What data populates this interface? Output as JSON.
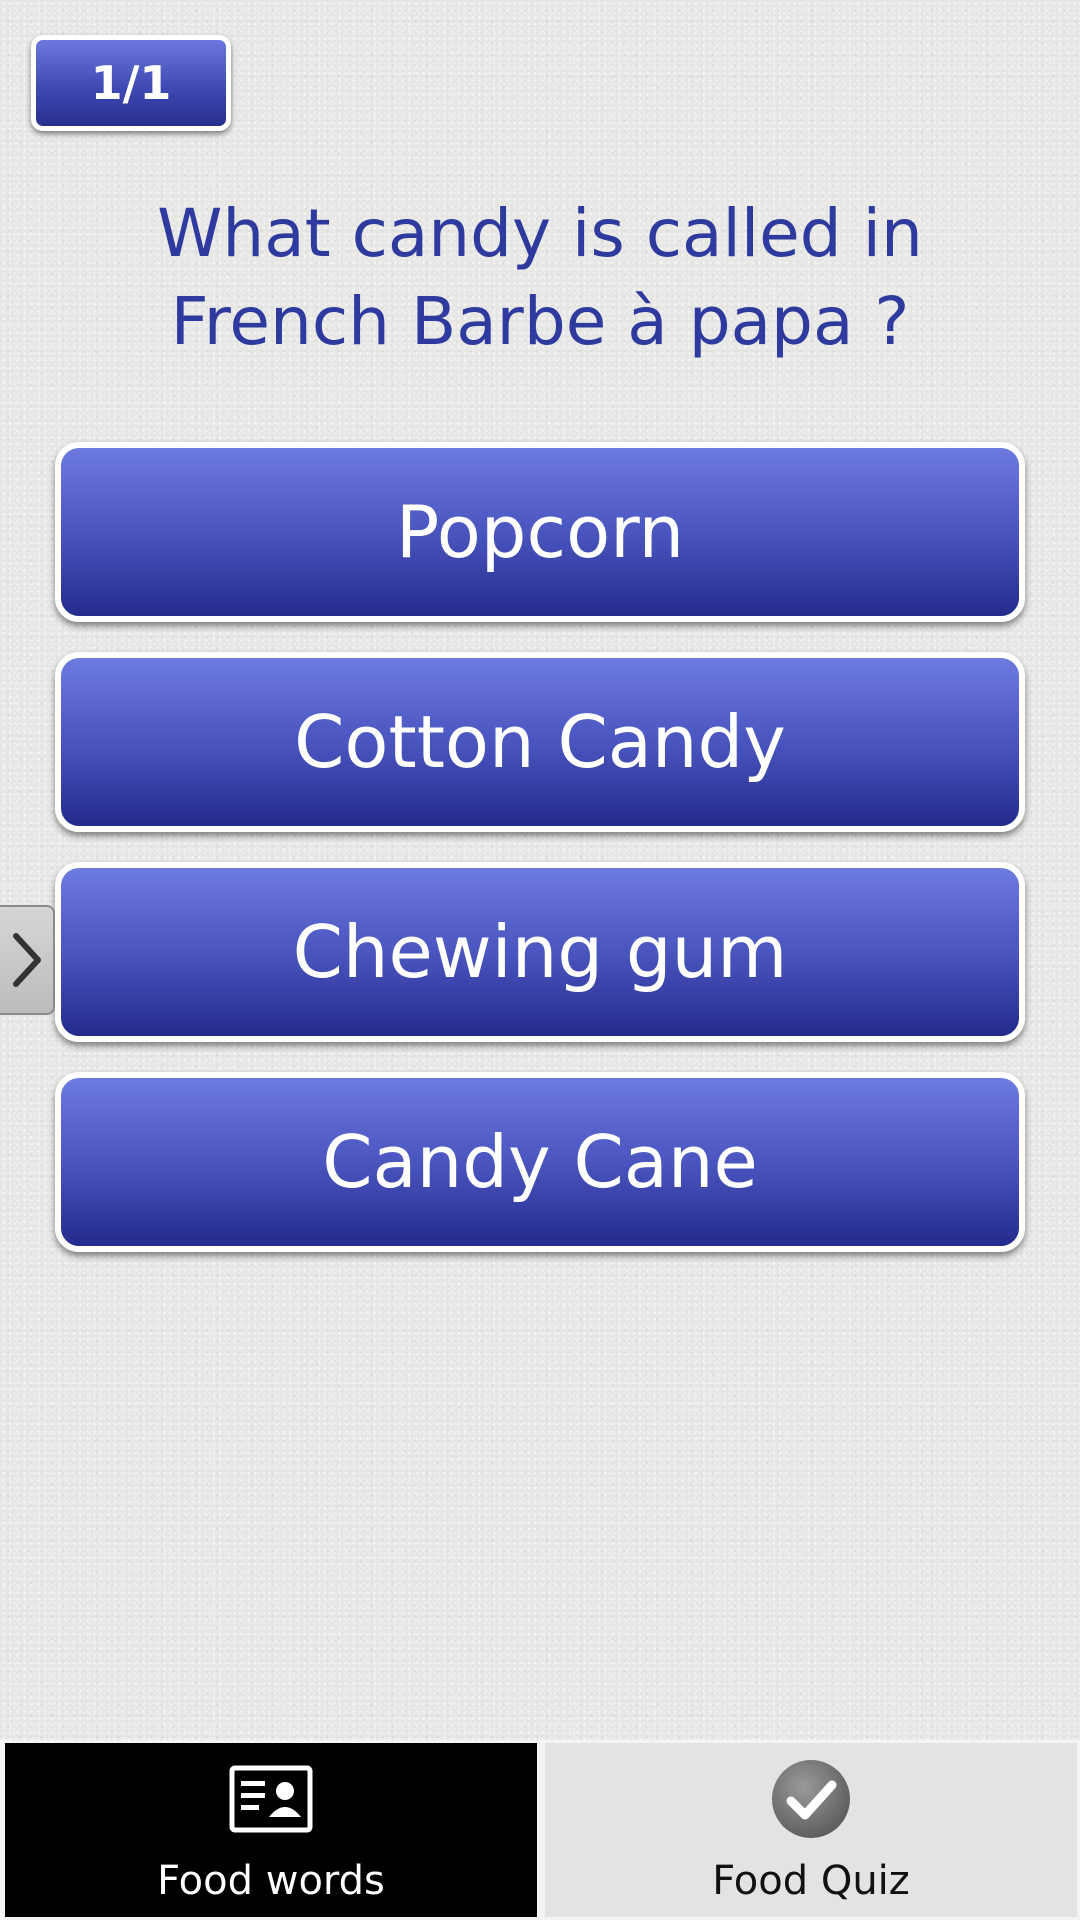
{
  "quiz": {
    "counter": "1/1",
    "question": "What candy is called in French Barbe à papa ?",
    "answers": [
      {
        "label": "Popcorn"
      },
      {
        "label": "Cotton Candy"
      },
      {
        "label": "Chewing gum"
      },
      {
        "label": "Candy Cane"
      }
    ]
  },
  "side_tab": {
    "icon": "chevron-right-icon"
  },
  "bottom_nav": {
    "items": [
      {
        "label": "Food words",
        "icon": "id-card-icon",
        "active": true
      },
      {
        "label": "Food Quiz",
        "icon": "check-circle-icon",
        "active": false
      }
    ]
  },
  "colors": {
    "question_text": "#2f3a9e",
    "button_top": "#6d7ae0",
    "button_bottom": "#232b8c",
    "nav_active_bg": "#000000",
    "nav_inactive_bg": "#e3e3e3"
  }
}
